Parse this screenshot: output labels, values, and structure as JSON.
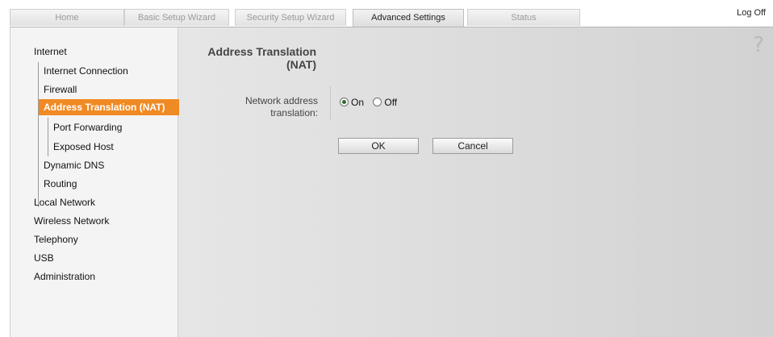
{
  "tabs": [
    {
      "label": "Home"
    },
    {
      "label": "Basic Setup Wizard"
    },
    {
      "label": "Security Setup Wizard"
    },
    {
      "label": "Advanced Settings"
    },
    {
      "label": "Status"
    }
  ],
  "header": {
    "logoff": "Log Off"
  },
  "sidebar": {
    "items": [
      {
        "label": "Internet"
      },
      {
        "label": "Internet Connection"
      },
      {
        "label": "Firewall"
      },
      {
        "label": "Address Translation (NAT)"
      },
      {
        "label": "Port Forwarding"
      },
      {
        "label": "Exposed Host"
      },
      {
        "label": "Dynamic DNS"
      },
      {
        "label": "Routing"
      },
      {
        "label": "Local Network"
      },
      {
        "label": "Wireless Network"
      },
      {
        "label": "Telephony"
      },
      {
        "label": "USB"
      },
      {
        "label": "Administration"
      }
    ]
  },
  "main": {
    "title": "Address Translation (NAT)",
    "field_label": "Network address translation:",
    "radio_on": "On",
    "radio_off": "Off",
    "selected": "On",
    "ok": "OK",
    "cancel": "Cancel",
    "help": "?"
  }
}
